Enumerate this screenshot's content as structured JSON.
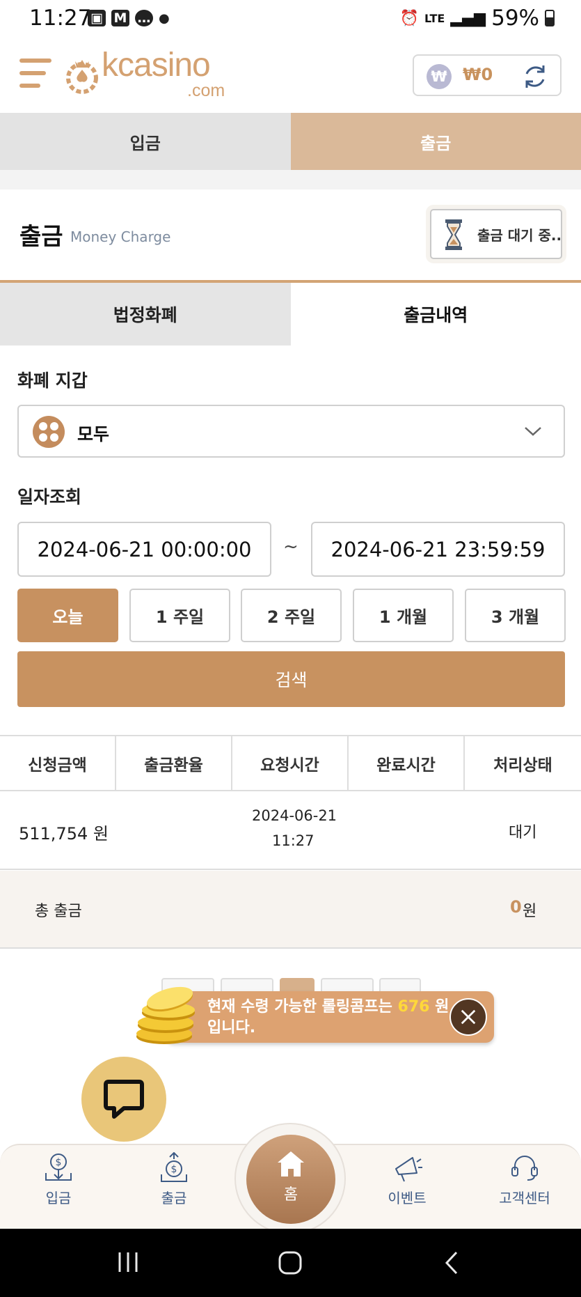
{
  "status_bar": {
    "time": "11:27",
    "battery": "59%",
    "network": "LTE"
  },
  "header": {
    "logo": "kcasino",
    "logo_domain": ".com",
    "balance": "₩0",
    "currency_symbol": "₩"
  },
  "top_tabs": [
    {
      "label": "입금"
    },
    {
      "label": "출금"
    }
  ],
  "section": {
    "title": "출금",
    "subtitle": "Money Charge",
    "pending_button": "출금 대기 중.."
  },
  "sub_tabs": [
    {
      "label": "법정화폐"
    },
    {
      "label": "출금내역"
    }
  ],
  "wallet_filter": {
    "label": "화폐 지갑",
    "selected": "모두"
  },
  "date_filter": {
    "label": "일자조회",
    "start": "2024-06-21 00:00:00",
    "separator": "~",
    "end": "2024-06-21 23:59:59",
    "ranges": [
      "오늘",
      "1 주일",
      "2 주일",
      "1 개월",
      "3 개월"
    ],
    "selected_index": 0
  },
  "search_button": "검색",
  "table": {
    "headers": [
      "신청금액",
      "출금환율",
      "요청시간",
      "완료시간",
      "처리상태"
    ],
    "rows": [
      {
        "amount": "511,754 원",
        "rate": "",
        "request_date": "2024-06-21",
        "request_time": "11:27",
        "complete_time": "",
        "status": "대기"
      }
    ]
  },
  "total": {
    "label": "총 출금",
    "value": "0",
    "unit": "원"
  },
  "banner": {
    "text_before": "현재 수령 가능한 롤링콤프는 ",
    "amount": "676",
    "text_after": " 원 입니다."
  },
  "bottom_nav": [
    {
      "label": "입금",
      "icon": "deposit-icon"
    },
    {
      "label": "출금",
      "icon": "withdraw-icon"
    },
    {
      "label": "홈",
      "icon": "home-icon"
    },
    {
      "label": "이벤트",
      "icon": "megaphone-icon"
    },
    {
      "label": "고객센터",
      "icon": "headset-icon"
    }
  ],
  "colors": {
    "accent": "#c89260",
    "tab_active": "#dab999",
    "banner": "#dda271",
    "chat": "#e9c679",
    "nav_text": "#3d5a85"
  }
}
